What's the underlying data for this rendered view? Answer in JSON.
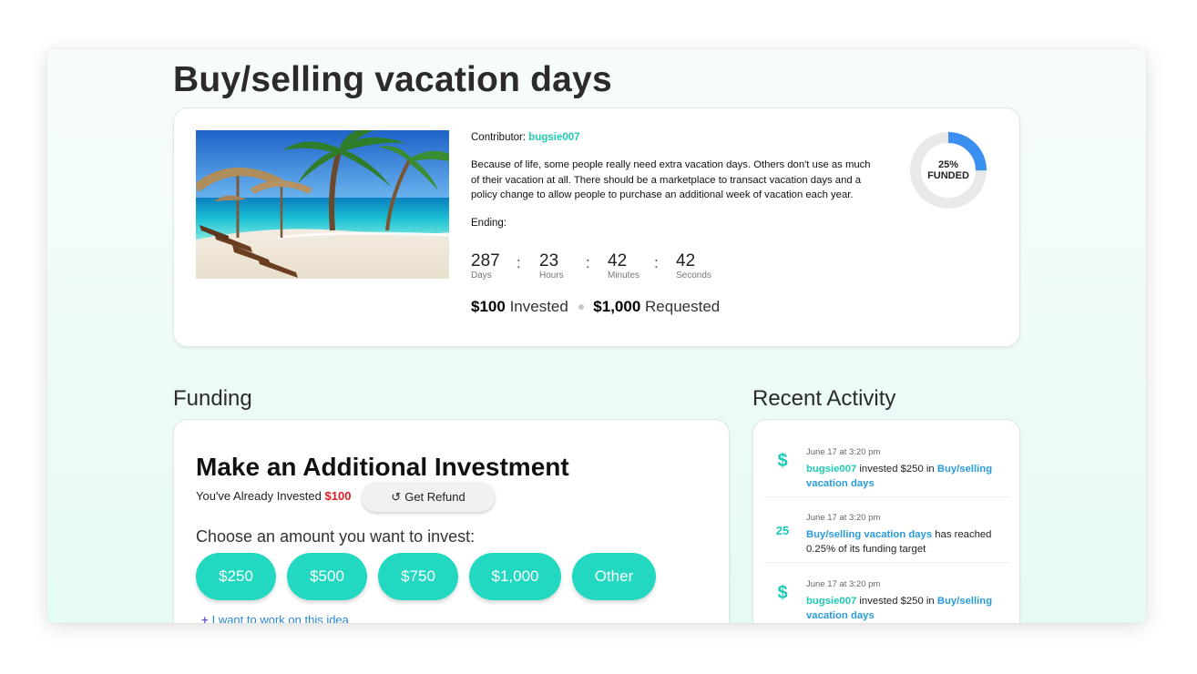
{
  "page": {
    "title": "Buy/selling vacation days"
  },
  "hero": {
    "contributor_label": "Contributor:",
    "contributor_name": "bugsie007",
    "description": "Because of life, some people really need extra vacation days. Others don't use as much of their vacation at all. There should be a marketplace to transact vacation days and a policy change to allow people to purchase an additional week of vacation each year.",
    "ending_label": "Ending:",
    "countdown": {
      "days": "287",
      "days_label": "Days",
      "hours": "23",
      "hours_label": "Hours",
      "minutes": "42",
      "minutes_label": "Minutes",
      "seconds": "42",
      "seconds_label": "Seconds",
      "separator": ":"
    },
    "invested_amount": "$100",
    "invested_label": "Invested",
    "requested_amount": "$1,000",
    "requested_label": "Requested",
    "funded_percent": "25%",
    "funded_label": "FUNDED",
    "funded_fraction": 0.25
  },
  "funding": {
    "section_title": "Funding",
    "heading": "Make an Additional Investment",
    "already_label": "You've Already Invested",
    "already_amount": "$100",
    "refund_label": "Get Refund",
    "choose_label": "Choose an amount you want to invest:",
    "amounts": [
      "$250",
      "$500",
      "$750",
      "$1,000",
      "Other"
    ],
    "work_link": "I want to work on this idea"
  },
  "activity": {
    "section_title": "Recent Activity",
    "items": [
      {
        "icon": "dollar-icon",
        "icon_text": "$",
        "time": "June 17 at 3:20 pm",
        "user": "bugsie007",
        "text": "invested $250 in",
        "link": "Buy/selling vacation days"
      },
      {
        "icon": "milestone-25-icon",
        "icon_text": "25",
        "time": "June 17 at 3:20 pm",
        "link": "Buy/selling vacation days",
        "text": "has reached 0.25% of its funding target"
      },
      {
        "icon": "dollar-icon",
        "icon_text": "$",
        "time": "June 17 at 3:20 pm",
        "user": "bugsie007",
        "text": "invested $250 in",
        "link": "Buy/selling vacation days"
      }
    ]
  },
  "colors": {
    "accent": "#22d8c0",
    "link": "#2a9bd8",
    "donut_fill": "#3b8ff0",
    "donut_track": "#e9e9e9",
    "warning_amount": "#e01b24"
  }
}
